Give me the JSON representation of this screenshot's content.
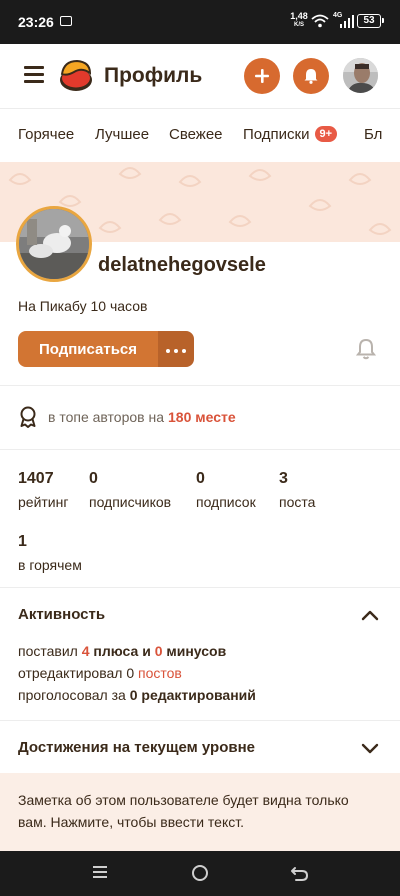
{
  "status_bar": {
    "time": "23:26",
    "speed_value": "1,48",
    "speed_unit": "K/S",
    "network": "4G",
    "battery": "53"
  },
  "header": {
    "title": "Профиль",
    "icons": [
      "menu-icon",
      "pikabu-logo",
      "plus-icon",
      "bell-icon",
      "user-avatar"
    ]
  },
  "tabs": [
    {
      "label": "Горячее"
    },
    {
      "label": "Лучшее"
    },
    {
      "label": "Свежее"
    },
    {
      "label": "Подписки",
      "badge": "9+"
    },
    {
      "label": "Бл"
    }
  ],
  "profile": {
    "username": "delatnehegovsele",
    "since": "На Пикабу 10 часов",
    "subscribe_label": "Подписаться"
  },
  "top_authors": {
    "prefix": "в топе авторов на",
    "rank": "180 месте"
  },
  "stats": [
    {
      "value": "1407",
      "label": "рейтинг"
    },
    {
      "value": "0",
      "label": "подписчиков"
    },
    {
      "value": "0",
      "label": "подписок"
    },
    {
      "value": "3",
      "label": "поста"
    },
    {
      "value": "1",
      "label": "в горячем"
    }
  ],
  "activity": {
    "title": "Активность",
    "line1": {
      "p1": "поставил",
      "plus_count": "4",
      "plus_word": "плюса",
      "and": "и",
      "minus_count": "0",
      "minus_word": "минусов"
    },
    "line2": {
      "p1": "отредактировал",
      "count": "0",
      "word": "постов"
    },
    "line3": {
      "p1": "проголосовал за",
      "count": "0",
      "word": "редактирований"
    }
  },
  "achievements": {
    "title": "Достижения на текущем уровне"
  },
  "note": {
    "text": "Заметка об этом пользователе будет видна только вам. Нажмите, чтобы ввести текст."
  },
  "colors": {
    "accent": "#d76a2f",
    "button": "#d27533",
    "badge": "#e85a45",
    "rank": "#d9533a",
    "banner": "#fbe7dc",
    "text": "#3b2a1a"
  }
}
